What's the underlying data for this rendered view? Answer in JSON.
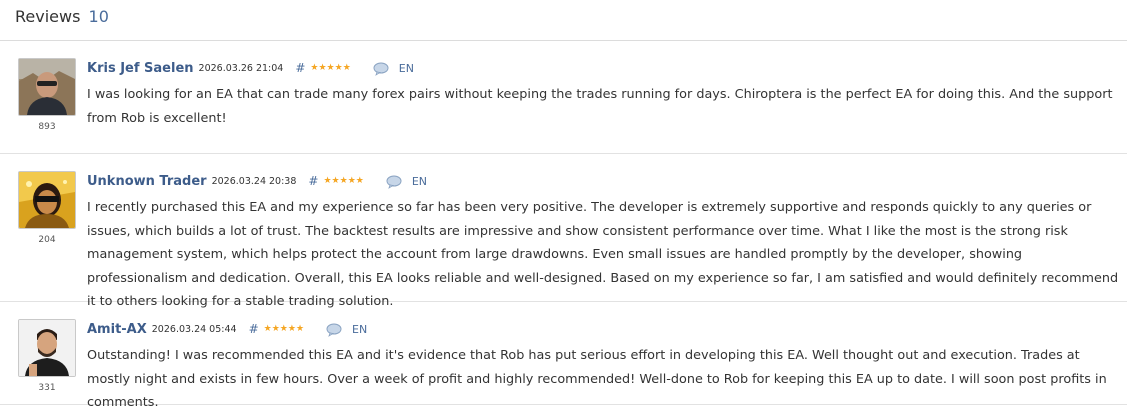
{
  "header": {
    "title": "Reviews",
    "count": "10"
  },
  "reviews": [
    {
      "author": "Kris Jef Saelen",
      "date": "2026.03.26 21:04",
      "hash": "#",
      "rating_stars": 5,
      "rating_points": "893",
      "lang": "EN",
      "text": "I was looking for an EA that can trade many forex pairs without keeping the trades running for days. Chiroptera is the perfect EA for doing this. And the support from Rob is excellent!"
    },
    {
      "author": "Unknown Trader",
      "date": "2026.03.24 20:38",
      "hash": "#",
      "rating_stars": 5,
      "rating_points": "204",
      "lang": "EN",
      "text": "I recently purchased this EA and my experience so far has been very positive. The developer is extremely supportive and responds quickly to any queries or issues, which builds a lot of trust. The backtest results are impressive and show consistent performance over time. What I like the most is the strong risk management system, which helps protect the account from large drawdowns. Even small issues are handled promptly by the developer, showing professionalism and dedication. Overall, this EA looks reliable and well-designed. Based on my experience so far, I am satisfied and would definitely recommend it to others looking for a stable trading solution."
    },
    {
      "author": "Amit-AX",
      "date": "2026.03.24 05:44",
      "hash": "#",
      "rating_stars": 5,
      "rating_points": "331",
      "lang": "EN",
      "text": "Outstanding! I was recommended this EA and it's evidence that Rob has put serious effort in developing this EA. Well thought out and execution. Trades at mostly night and exists in few hours. Over a week of profit and highly recommended! Well-done to Rob for keeping this EA up to date. I will soon post profits in comments."
    }
  ],
  "colors": {
    "author": "#3d5c8a",
    "accent": "#4a6c9b",
    "star": "#f5a623"
  },
  "icons": {
    "comment": "speech-bubble-icon",
    "star": "star-icon"
  }
}
